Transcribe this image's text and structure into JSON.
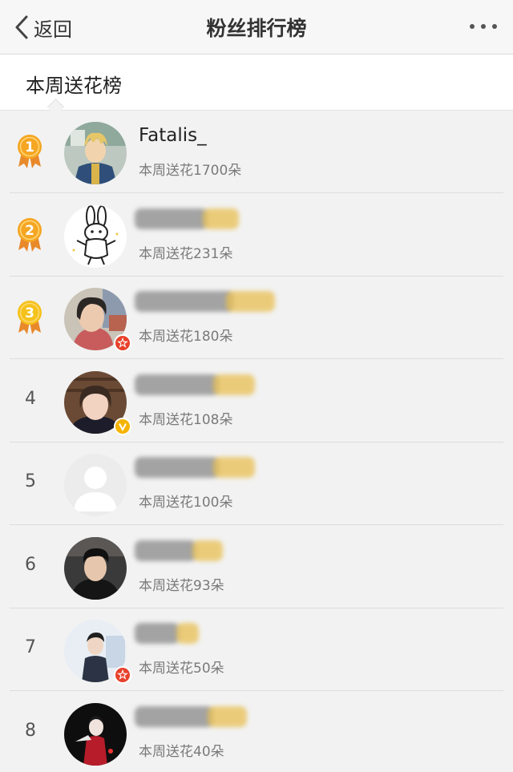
{
  "nav": {
    "back_label": "返回",
    "title": "粉丝排行榜",
    "more_icon": "more-dots-icon"
  },
  "tab": {
    "label": "本周送花榜"
  },
  "colors": {
    "nav_bg": "#f7f7f7",
    "list_bg": "#f2f2f2",
    "medal_gold": "#f5a623",
    "medal_ribbon": "#e8892b",
    "badge_red": "#e8412b",
    "badge_yellow": "#f5b400",
    "blur_gray": "#6f6f6f",
    "blur_yellow": "#e8bf52"
  },
  "rankings": [
    {
      "rank": "1",
      "name": "Fatalis_",
      "name_visible": true,
      "count_text": "本周送花1700朵",
      "medal": "1",
      "badge": ""
    },
    {
      "rank": "2",
      "name": "",
      "name_visible": false,
      "count_text": "本周送花231朵",
      "medal": "2",
      "badge": ""
    },
    {
      "rank": "3",
      "name": "",
      "name_visible": false,
      "count_text": "本周送花180朵",
      "medal": "3",
      "badge": "red-star"
    },
    {
      "rank": "4",
      "name": "",
      "name_visible": false,
      "count_text": "本周送花108朵",
      "medal": "",
      "badge": "yellow-v"
    },
    {
      "rank": "5",
      "name": "",
      "name_visible": false,
      "count_text": "本周送花100朵",
      "medal": "",
      "badge": ""
    },
    {
      "rank": "6",
      "name": "",
      "name_visible": false,
      "count_text": "本周送花93朵",
      "medal": "",
      "badge": ""
    },
    {
      "rank": "7",
      "name": "",
      "name_visible": false,
      "count_text": "本周送花50朵",
      "medal": "",
      "badge": "red-star"
    },
    {
      "rank": "8",
      "name": "",
      "name_visible": false,
      "count_text": "本周送花40朵",
      "medal": "",
      "badge": ""
    }
  ]
}
